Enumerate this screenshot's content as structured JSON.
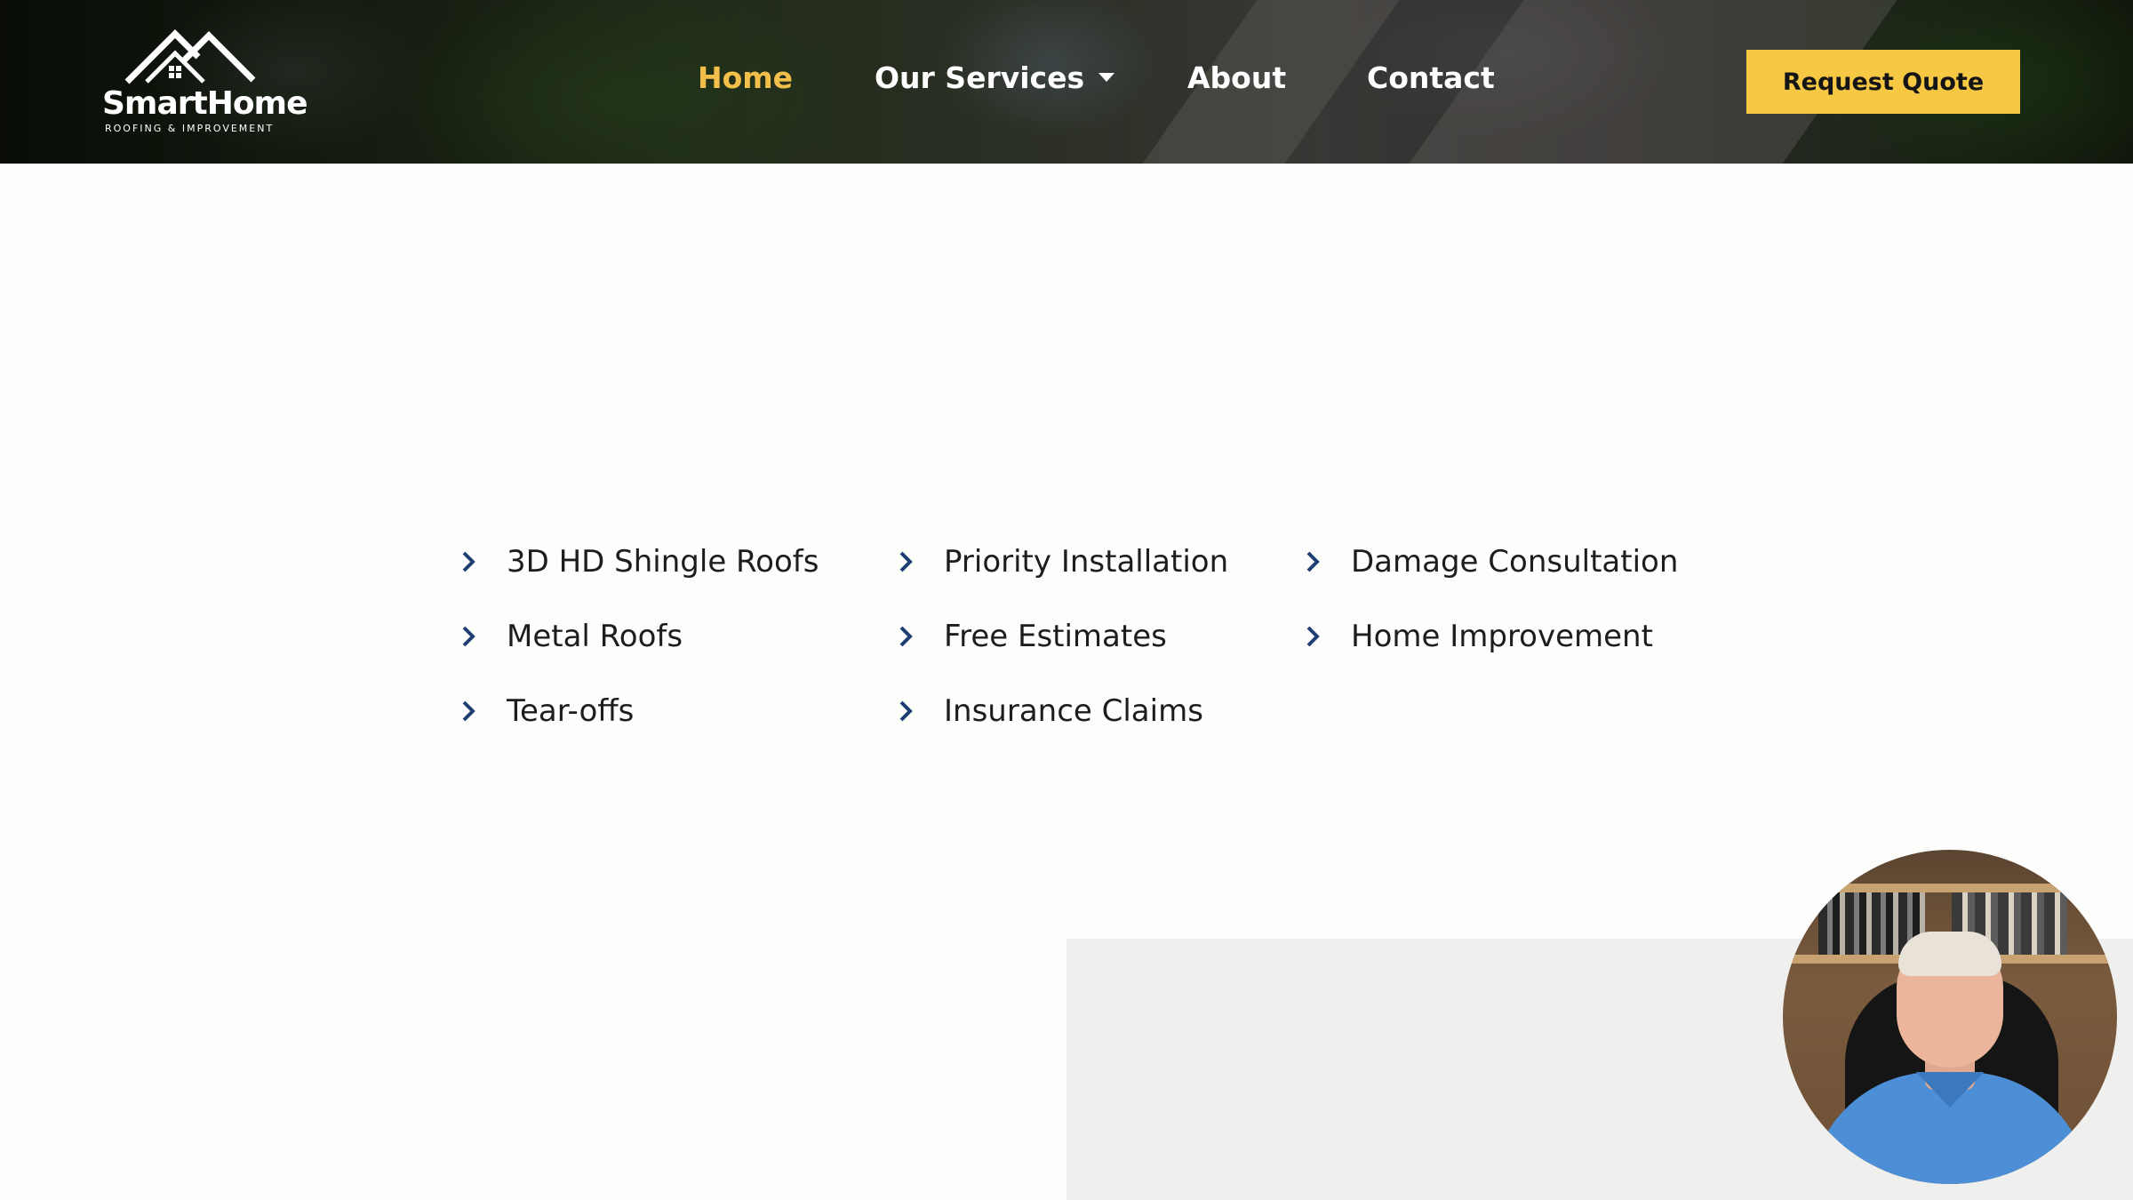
{
  "header": {
    "logo": {
      "name": "SmartHome",
      "tagline": "ROOFING & IMPROVEMENT"
    },
    "nav": [
      {
        "label": "Home",
        "active": true
      },
      {
        "label": "Our Services",
        "has_dropdown": true
      },
      {
        "label": "About"
      },
      {
        "label": "Contact"
      }
    ],
    "cta_label": "Request Quote",
    "colors": {
      "active_nav": "#f2c04a",
      "cta_background": "#f7c844"
    }
  },
  "features": {
    "columns": [
      [
        "3D HD Shingle Roofs",
        "Metal Roofs",
        "Tear-offs"
      ],
      [
        "Priority Installation",
        "Free Estimates",
        "Insurance Claims"
      ],
      [
        "Damage Consultation",
        "Home Improvement"
      ]
    ],
    "icon": "chevron-right-icon",
    "icon_color": "#1f3f73"
  },
  "webcam": {
    "icon": "presenter-webcam"
  }
}
